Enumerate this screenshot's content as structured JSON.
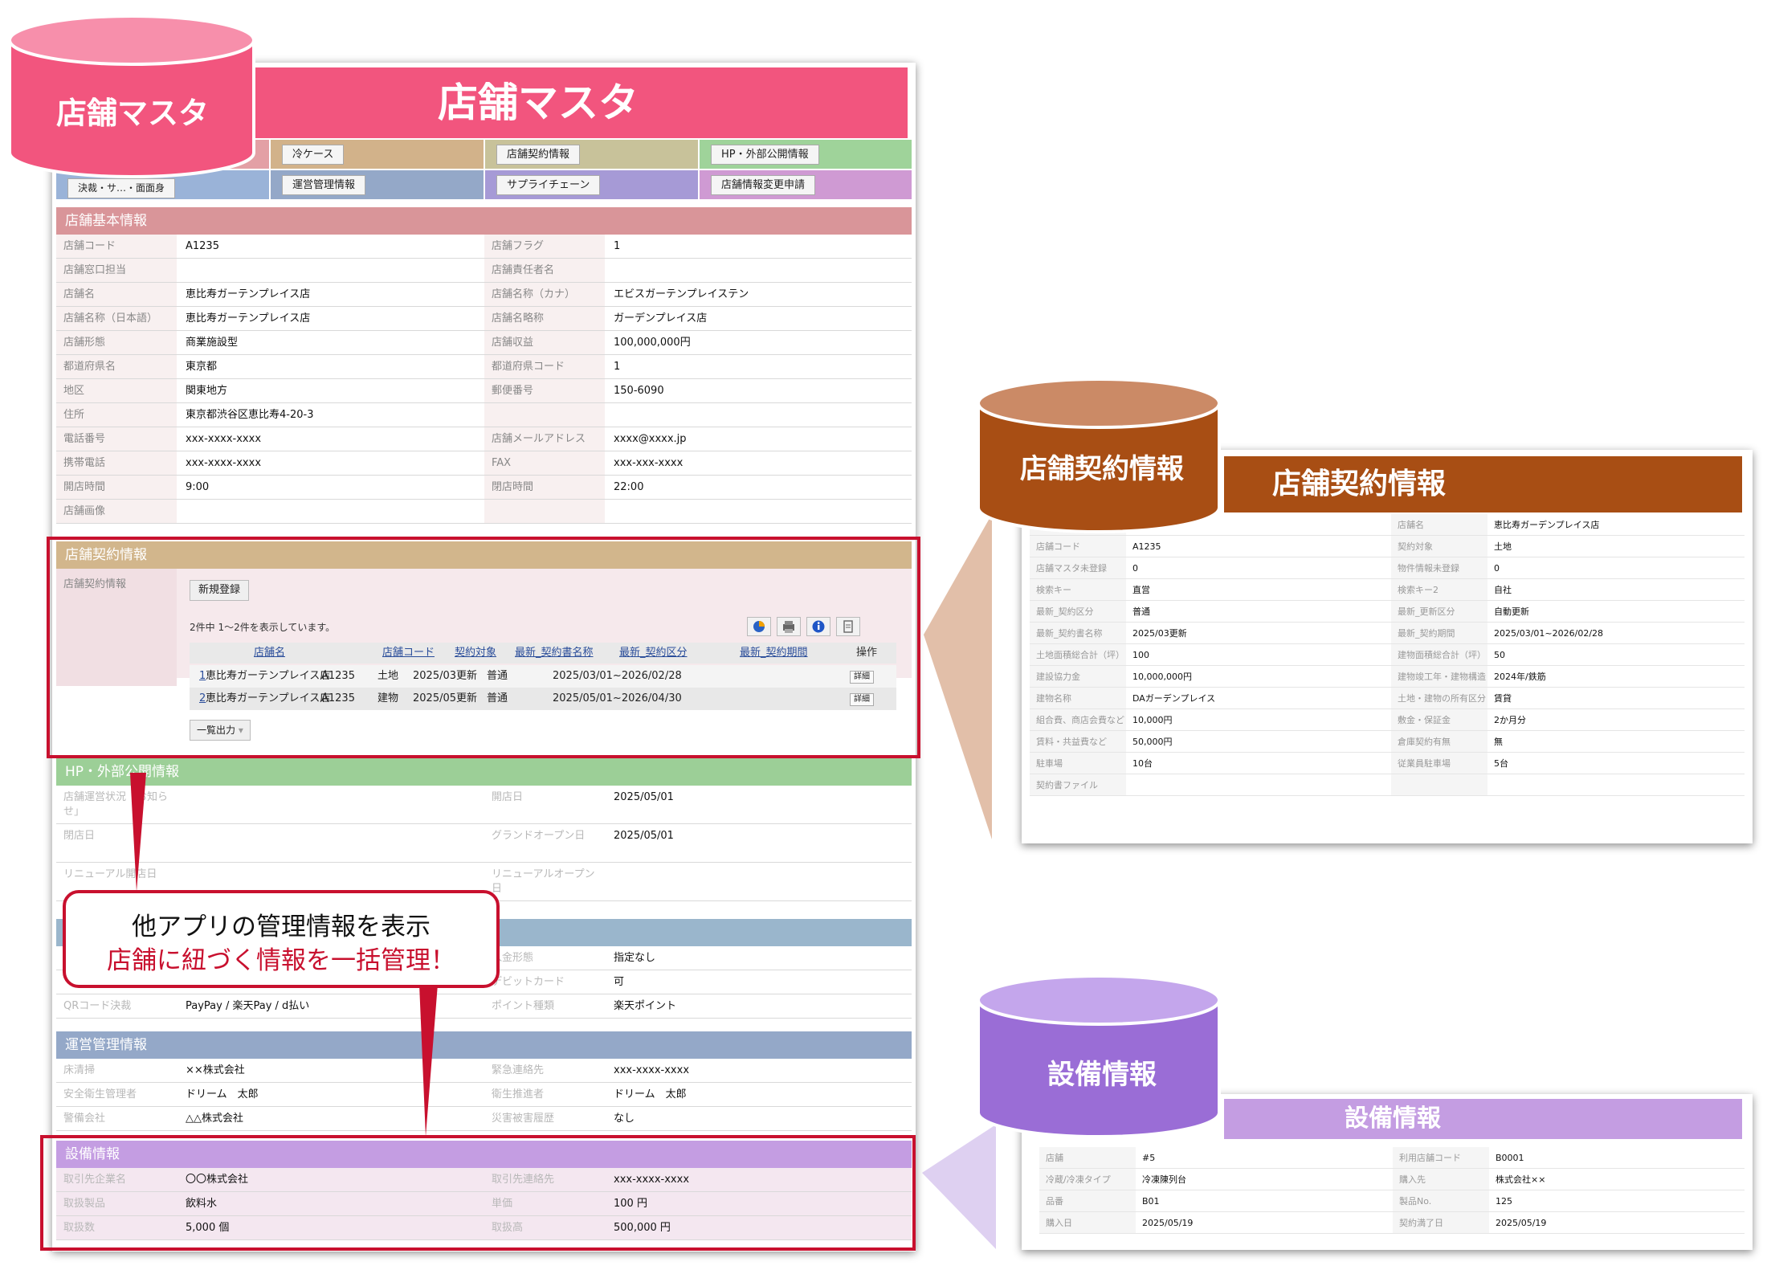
{
  "main": {
    "db_label": "店舗マスタ",
    "title": "店舗マスタ",
    "tabs_row1": [
      "冷ケース",
      "店舗契約情報",
      "HP・外部公開情報"
    ],
    "tabs_row2_partial": "決裁・サ…・面面身",
    "tabs_row2": [
      "運営管理情報",
      "サプライチェーン",
      "店舗情報変更申請"
    ],
    "basic": {
      "header": "店舗基本情報",
      "rows": [
        [
          "店舗コード",
          "A1235",
          "店舗フラグ",
          "1"
        ],
        [
          "店舗窓口担当",
          "",
          "店舗責任者名",
          ""
        ],
        [
          "店舗名",
          "恵比寿ガーテンプレイス店",
          "店舗名称（カナ）",
          "エビスガーテンプレイステン"
        ],
        [
          "店舗名称（日本語）",
          "恵比寿ガーテンプレイス店",
          "店舗名略称",
          "ガーデンプレイス店"
        ],
        [
          "店舗形態",
          "商業施設型",
          "店舗収益",
          "100,000,000円"
        ],
        [
          "都道府県名",
          "東京都",
          "都道府県コード",
          "1"
        ],
        [
          "地区",
          "関東地方",
          "郵便番号",
          "150-6090"
        ],
        [
          "住所",
          "東京都渋谷区恵比寿4-20-3",
          "",
          ""
        ],
        [
          "電話番号",
          "xxx-xxxx-xxxx",
          "店舗メールアドレス",
          "xxxx@xxxx.jp"
        ],
        [
          "携帯電話",
          "xxx-xxxx-xxxx",
          "FAX",
          "xxx-xxx-xxxx"
        ],
        [
          "開店時間",
          "9:00",
          "閉店時間",
          "22:00"
        ],
        [
          "店舗画像",
          "",
          "",
          ""
        ]
      ]
    },
    "contract": {
      "header": "店舗契約情報",
      "label": "店舗契約情報",
      "new_button": "新規登録",
      "count_text": "2件中 1〜2件を表示しています。",
      "columns": [
        "店舗名",
        "店舗コード",
        "契約対象",
        "最新_契約書名称",
        "最新_契約区分",
        "最新_契約期間",
        "操作"
      ],
      "rows": [
        [
          "1",
          "恵比寿ガーテンプレイス店",
          "A1235",
          "土地",
          "2025/03更新",
          "普通",
          "2025/03/01~2026/02/28",
          "詳細"
        ],
        [
          "2",
          "恵比寿ガーテンプレイス店",
          "A1235",
          "建物",
          "2025/05更新",
          "普通",
          "2025/05/01~2026/04/30",
          "詳細"
        ]
      ],
      "export_button": "一覧出力"
    },
    "hp": {
      "header": "HP・外部公開情報",
      "rows": [
        [
          "店舗運営状況「お知らせ」",
          "",
          "開店日",
          "2025/05/01"
        ],
        [
          "閉店日",
          "",
          "グランドオープン日",
          "2025/05/01"
        ],
        [
          "リニューアル開店日",
          "",
          "リニューアルオープン日",
          ""
        ]
      ]
    },
    "payment": {
      "rows": [
        [
          "",
          "",
          "入金形態",
          "指定なし"
        ],
        [
          "",
          "",
          "デビットカード",
          "可"
        ],
        [
          "QRコード決裁",
          "PayPay / 楽天Pay / d払い",
          "ポイント種類",
          "楽天ポイント"
        ]
      ]
    },
    "ops": {
      "header": "運営管理情報",
      "rows": [
        [
          "床清掃",
          "××株式会社",
          "緊急連絡先",
          "xxx-xxxx-xxxx"
        ],
        [
          "安全衛生管理者",
          "ドリーム　太郎",
          "衛生推進者",
          "ドリーム　太郎"
        ],
        [
          "警備会社",
          "△△株式会社",
          "災害被害履歴",
          "なし"
        ]
      ]
    },
    "equip": {
      "header": "設備情報",
      "rows": [
        [
          "取引先企業名",
          "〇〇株式会社",
          "取引先連絡先",
          "xxx-xxxx-xxxx"
        ],
        [
          "取扱製品",
          "飲料水",
          "単価",
          "100 円"
        ],
        [
          "取扱数",
          "5,000 個",
          "取扱高",
          "500,000 円"
        ]
      ]
    }
  },
  "callout": {
    "line1": "他アプリの管理情報を表示",
    "line2": "店舗に紐づく情報を一括管理！"
  },
  "contract_panel": {
    "db_label": "店舗契約情報",
    "title": "店舗契約情報",
    "rows": [
      [
        "",
        "",
        "店舗名",
        "恵比寿ガーデンプレイス店"
      ],
      [
        "店舗コード",
        "A1235",
        "契約対象",
        "土地"
      ],
      [
        "店舗マスタ未登録",
        "0",
        "物件情報未登録",
        "0"
      ],
      [
        "検索キー",
        "直営",
        "検索キー2",
        "自社"
      ],
      [
        "最新_契約区分",
        "普通",
        "最新_更新区分",
        "自動更新"
      ],
      [
        "最新_契約書名称",
        "2025/03更新",
        "最新_契約期間",
        "2025/03/01~2026/02/28"
      ],
      [
        "土地面積総合計（坪）",
        "100",
        "建物面積総合計（坪）",
        "50"
      ],
      [
        "建設協力金",
        "10,000,000円",
        "建物竣工年・建物構造",
        "2024年/鉄筋"
      ],
      [
        "建物名称",
        "DAガーデンプレイス",
        "土地・建物の所有区分",
        "賃貸"
      ],
      [
        "組合費、商店会費など",
        "10,000円",
        "敷金・保証金",
        "2か月分"
      ],
      [
        "賃料・共益費など",
        "50,000円",
        "倉庫契約有無",
        "無"
      ],
      [
        "駐車場",
        "10台",
        "従業員駐車場",
        "5台"
      ],
      [
        "契約書ファイル",
        "",
        "",
        ""
      ]
    ]
  },
  "equip_panel": {
    "db_label": "設備情報",
    "title": "設備情報",
    "rows": [
      [
        "店舗",
        "#5",
        "利用店舗コード",
        "B0001"
      ],
      [
        "冷蔵/冷凍タイプ",
        "冷凍陳列台",
        "購入先",
        "株式会社××"
      ],
      [
        "品番",
        "B01",
        "製品No.",
        "125"
      ],
      [
        "購入日",
        "2025/05/19",
        "契約満了日",
        "2025/05/19"
      ]
    ]
  },
  "colors": {
    "master": "#f2557e",
    "contract": "#a84e14",
    "equipment": "#9a6dd6",
    "highlight": "#c8102e"
  }
}
